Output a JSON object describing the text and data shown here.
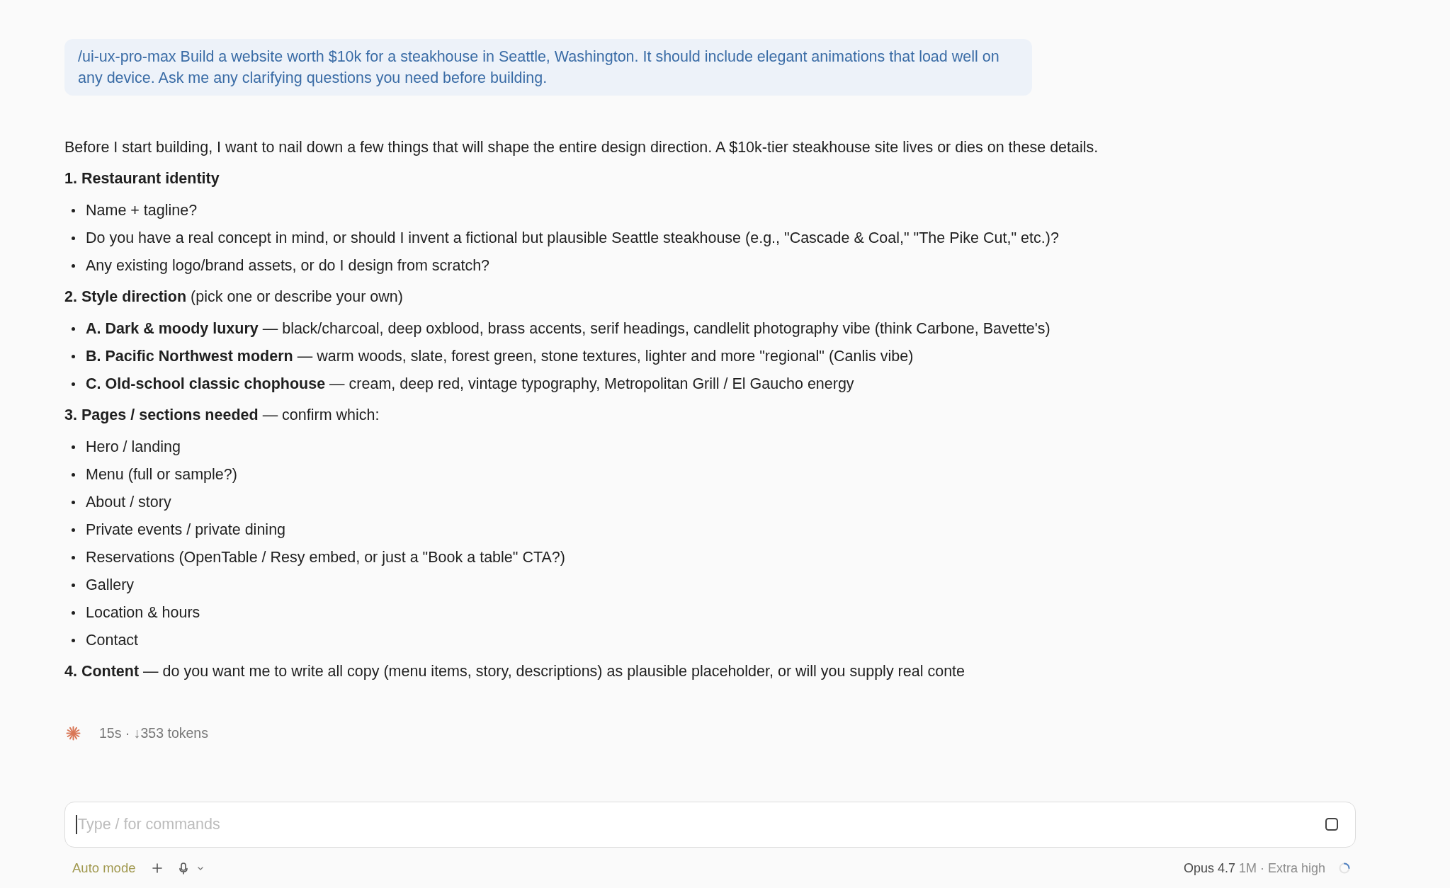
{
  "user_message": {
    "text": "/ui-ux-pro-max Build a website worth $10k for a steakhouse in Seattle, Washington. It should include elegant animations that load well on any device. Ask me any clarifying questions you need before building."
  },
  "response": {
    "intro": "Before I start building, I want to nail down a few things that will shape the entire design direction. A $10k-tier steakhouse site lives or dies on these details.",
    "sections": [
      {
        "title": "1. Restaurant identity",
        "items": [
          "Name + tagline?",
          "Do you have a real concept in mind, or should I invent a fictional but plausible Seattle steakhouse (e.g., \"Cascade & Coal,\" \"The Pike Cut,\" etc.)?",
          "Any existing logo/brand assets, or do I design from scratch?"
        ]
      },
      {
        "title": "2. Style direction",
        "note": "(pick one or describe your own)",
        "items": [
          "**A. Dark & moody luxury** — black/charcoal, deep oxblood, brass accents, serif headings, candlelit photography vibe (think Carbone, Bavette's)",
          "**B. Pacific Northwest modern** — warm woods, slate, forest green, stone textures, lighter and more \"regional\" (Canlis vibe)",
          "**C. Old-school classic chophouse** — cream, deep red, vintage typography, Metropolitan Grill / El Gaucho energy"
        ]
      },
      {
        "title": "3. Pages / sections needed",
        "note": "— confirm which:",
        "items": [
          "Hero / landing",
          "Menu (full or sample?)",
          "About / story",
          "Private events / private dining",
          "Reservations (OpenTable / Resy embed, or just a \"Book a table\" CTA?)",
          "Gallery",
          "Location & hours",
          "Contact"
        ]
      },
      {
        "title": "4. Content",
        "note": "— do you want me to write all copy (menu items, story, descriptions) as plausible placeholder, or will you supply real conte"
      }
    ]
  },
  "status": {
    "text": "15s · ↓353 tokens"
  },
  "composer": {
    "placeholder": "Type / for commands",
    "mode": "Auto mode",
    "model": "Opus 4.7",
    "model_detail": "1M · Extra high"
  }
}
